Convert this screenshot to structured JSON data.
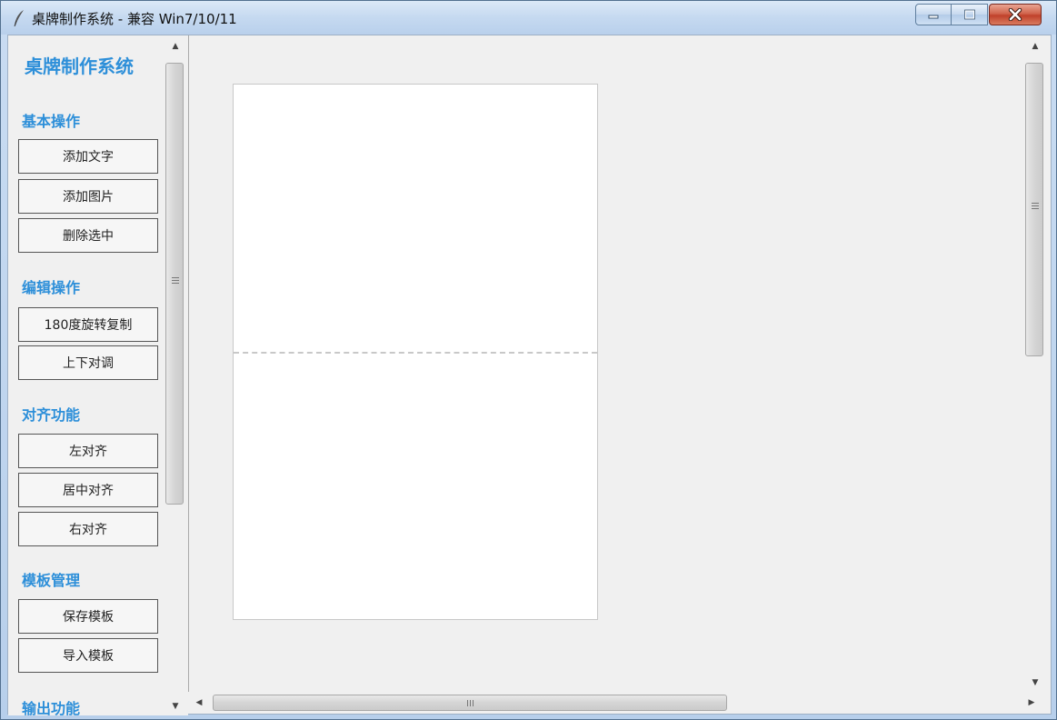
{
  "window": {
    "title": "桌牌制作系统 - 兼容 Win7/10/11"
  },
  "sidebar": {
    "app_title": "桌牌制作系统",
    "sections": [
      {
        "title": "基本操作",
        "buttons": [
          "添加文字",
          "添加图片",
          "删除选中"
        ]
      },
      {
        "title": "编辑操作",
        "buttons": [
          "180度旋转复制",
          "上下对调"
        ]
      },
      {
        "title": "对齐功能",
        "buttons": [
          "左对齐",
          "居中对齐",
          "右对齐"
        ]
      },
      {
        "title": "模板管理",
        "buttons": [
          "保存模板",
          "导入模板"
        ]
      },
      {
        "title": "输出功能",
        "buttons": []
      }
    ]
  },
  "icons": {
    "app": "feather-icon",
    "minimize": "minimize-icon",
    "maximize": "maximize-icon",
    "close": "close-icon"
  },
  "colors": {
    "accent": "#2d8fd9",
    "close_button": "#c0412a"
  }
}
